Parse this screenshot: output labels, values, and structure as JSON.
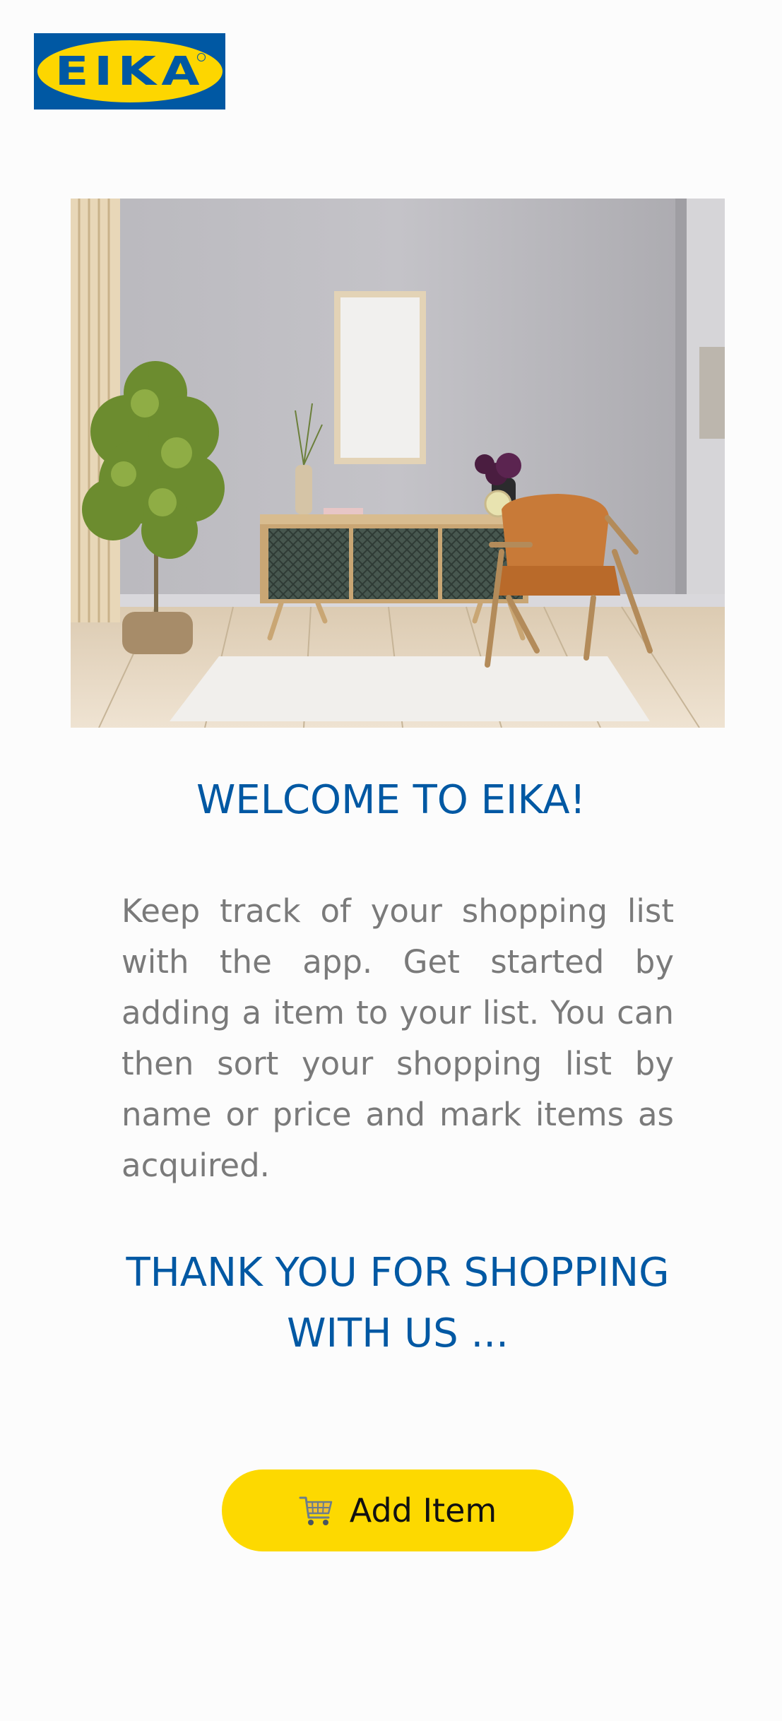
{
  "brand": {
    "logo_text": "EIKA",
    "colors": {
      "blue": "#0058a3",
      "yellow": "#fdd600",
      "body_text": "#7a7a7a",
      "background": "#fcfcfc"
    }
  },
  "hero": {
    "image_alt": "Living room with sideboard, framed picture, plant, and armchair"
  },
  "welcome": {
    "title": "WELCOME TO EIKA!"
  },
  "intro": {
    "text": "Keep track of your shopping list with the app. Get started by adding a item to your list. You can then sort your shopping list by name or price and mark items as acquired."
  },
  "thanks": {
    "text": "THANK YOU FOR SHOPPING WITH US ..."
  },
  "actions": {
    "add_item_label": "Add Item",
    "add_item_icon": "shopping-cart-icon"
  }
}
